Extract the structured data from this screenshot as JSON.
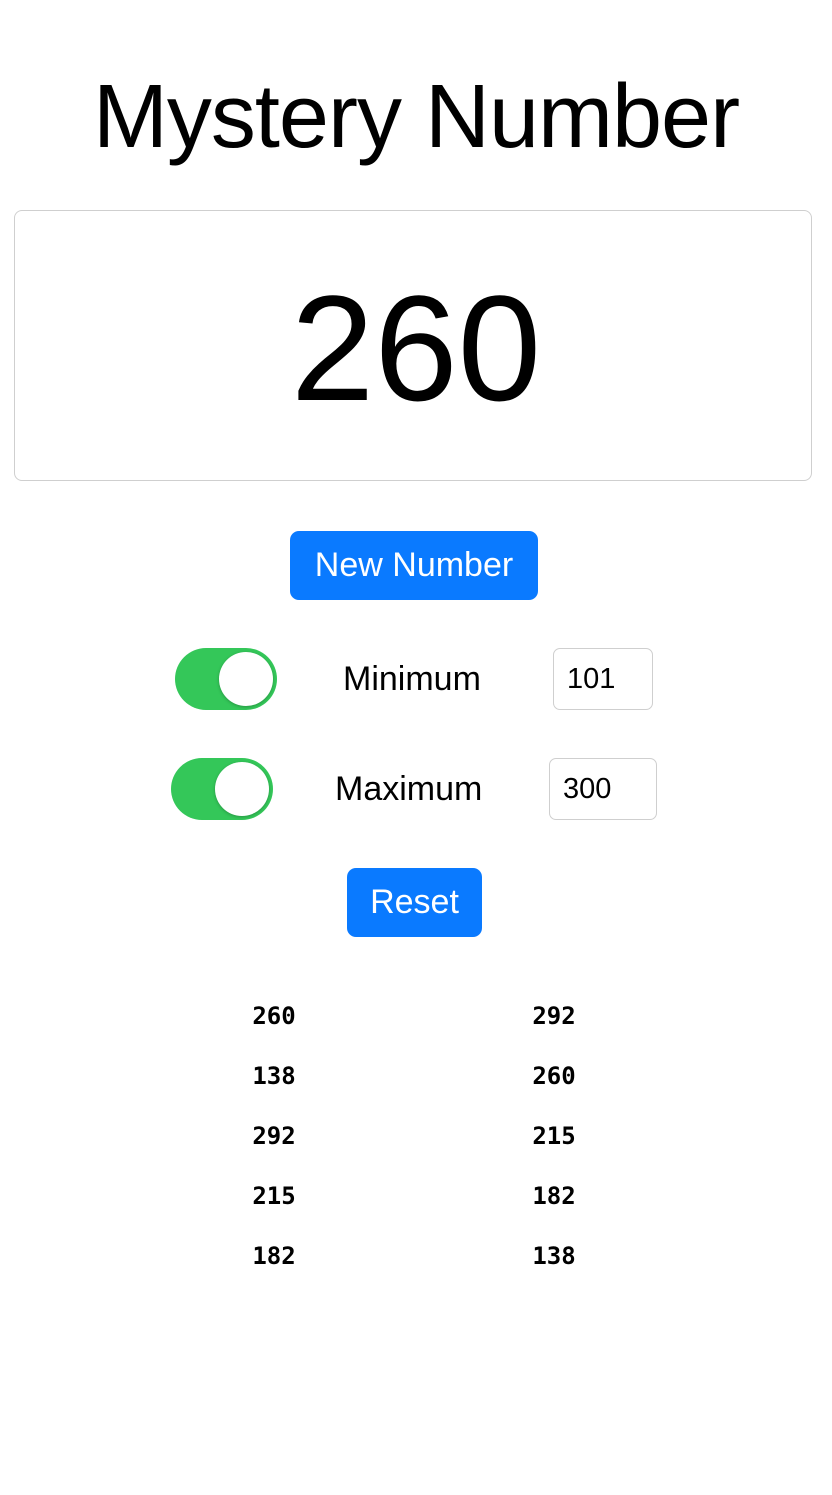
{
  "app": {
    "title": "Mystery Number"
  },
  "display": {
    "current_number": "260"
  },
  "buttons": {
    "new_number_label": "New Number",
    "reset_label": "Reset"
  },
  "range": {
    "minimum": {
      "label": "Minimum",
      "value": "101",
      "enabled": true
    },
    "maximum": {
      "label": "Maximum",
      "value": "300",
      "enabled": true
    }
  },
  "history": {
    "left_column": [
      "260",
      "138",
      "292",
      "215",
      "182"
    ],
    "right_column": [
      "292",
      "260",
      "215",
      "182",
      "138"
    ]
  },
  "colors": {
    "accent_blue": "#0a7aff",
    "toggle_on_green": "#34c759",
    "border_gray": "#cfcfcf"
  }
}
